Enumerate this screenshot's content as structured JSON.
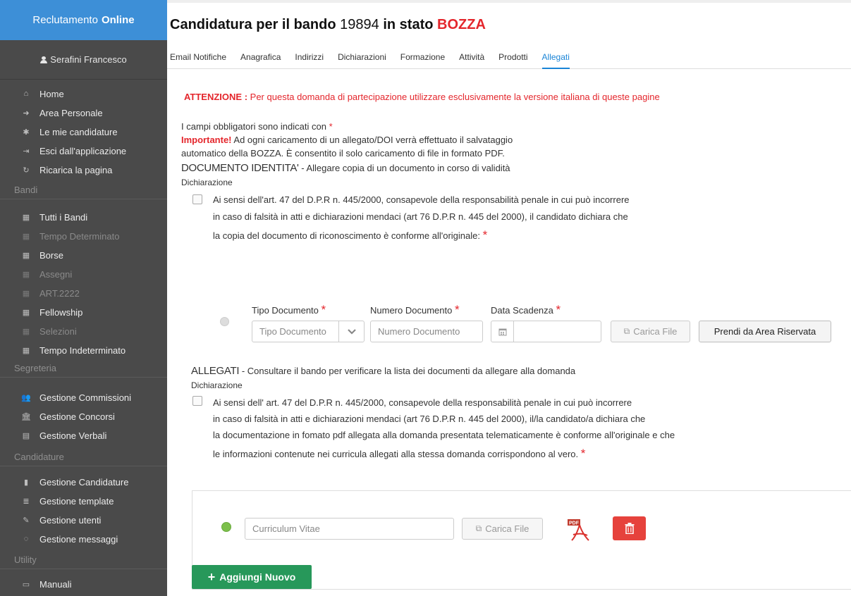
{
  "sidebar": {
    "brand_prefix": "Reclutamento",
    "brand_bold": "Online",
    "user": "Serafini Francesco",
    "items": [
      {
        "label": "Home",
        "icon": "home-icon",
        "glyph": "⌂"
      },
      {
        "label": "Area Personale",
        "icon": "sign-in-icon",
        "glyph": "➜"
      },
      {
        "label": "Le mie candidature",
        "icon": "bug-icon",
        "glyph": "✱"
      },
      {
        "label": "Esci dall'applicazione",
        "icon": "sign-out-icon",
        "glyph": "⇥"
      },
      {
        "label": "Ricarica la pagina",
        "icon": "refresh-icon",
        "glyph": "↻"
      }
    ],
    "section_bandi": "Bandi",
    "bandi_items": [
      {
        "label": "Tutti i Bandi",
        "icon": "database-icon",
        "dim": false
      },
      {
        "label": "Tempo Determinato",
        "icon": "database-icon",
        "dim": true
      },
      {
        "label": "Borse",
        "icon": "database-icon",
        "dim": false
      },
      {
        "label": "Assegni",
        "icon": "database-icon",
        "dim": true
      },
      {
        "label": "ART.2222",
        "icon": "database-icon",
        "dim": true
      },
      {
        "label": "Fellowship",
        "icon": "database-icon",
        "dim": false
      },
      {
        "label": "Selezioni",
        "icon": "database-icon",
        "dim": true
      },
      {
        "label": "Tempo Indeterminato",
        "icon": "database-icon",
        "dim": false
      }
    ],
    "section_segreteria": "Segreteria",
    "segreteria_items": [
      {
        "label": "Gestione Commissioni",
        "icon": "users-icon",
        "glyph": "👥"
      },
      {
        "label": "Gestione Concorsi",
        "icon": "bank-icon",
        "glyph": "🏛"
      },
      {
        "label": "Gestione Verbali",
        "icon": "file-icon",
        "glyph": "▤"
      }
    ],
    "section_candidature": "Candidature",
    "candidature_items": [
      {
        "label": "Gestione Candidature",
        "icon": "book-icon",
        "glyph": "▮"
      },
      {
        "label": "Gestione template",
        "icon": "list-icon",
        "glyph": "≣"
      },
      {
        "label": "Gestione utenti",
        "icon": "pencil-icon",
        "glyph": "✎"
      },
      {
        "label": "Gestione messaggi",
        "icon": "comment-icon",
        "glyph": "◌"
      }
    ],
    "section_utility": "Utility",
    "utility_items": [
      {
        "label": "Manuali",
        "icon": "folder-icon",
        "glyph": "▭"
      }
    ]
  },
  "header": {
    "title_prefix": "Candidatura per il bando",
    "bando_number": "19894",
    "title_mid": "in stato",
    "state": "BOZZA"
  },
  "tabs": [
    "Email Notifiche",
    "Anagrafica",
    "Indirizzi",
    "Dichiarazioni",
    "Formazione",
    "Attività",
    "Prodotti",
    "Allegati"
  ],
  "active_tab": "Allegati",
  "content": {
    "warning_bold": "ATTENZIONE :",
    "warning_text": "Per questa domanda di partecipazione utilizzare esclusivamente la versione italiana di queste pagine",
    "required_note": "I campi obbligatori sono indicati con",
    "required_star": "*",
    "important_bold": "Importante!",
    "important_line1": "Ad ogni caricamento di un allegato/DOI verrà effettuato il salvataggio",
    "important_line2": "automatico della BOZZA. È consentito il solo caricamento di file in formato PDF.",
    "doc_heading_caps": "DOCUMENTO IDENTITA'",
    "doc_heading_rest": "- Allegare copia di un documento in corso di validità",
    "dichiarazione_label": "Dichiarazione",
    "decl1_line1": "Ai sensi dell'art. 47 del D.P.R n. 445/2000, consapevole della responsabilità penale in cui può incorrere",
    "decl1_line2": "in caso di falsità in atti e dichiarazioni mendaci (art 76 D.P.R n. 445 del 2000), il candidato dichiara che",
    "decl1_line3": "la copia del documento di riconoscimento è conforme all'originale:",
    "tipo_documento_label": "Tipo Documento",
    "numero_documento_label": "Numero Documento",
    "data_scadenza_label": "Data Scadenza",
    "tipo_documento_placeholder": "Tipo Documento",
    "numero_documento_placeholder": "Numero Documento",
    "carica_file": "Carica File",
    "prendi_area": "Prendi da Area Riservata",
    "allegati_heading_caps": "ALLEGATI",
    "allegati_heading_rest": "- Consultare il bando per verificare la lista dei documenti da allegare alla domanda",
    "decl2_line1": "Ai sensi dell' art. 47 del D.P.R n. 445/2000, consapevole della responsabilità penale in cui può incorrere",
    "decl2_line2": "in caso di falsità in atti e dichiarazioni mendaci (art 76 D.P.R n. 445 del 2000), il/la candidato/a dichiara che",
    "decl2_line3": "la documentazione in fomato pdf allegata alla domanda presentata telematicamente è conforme all'originale e che",
    "decl2_line4": "le informazioni contenute nei curricula allegati alla stessa domanda corrispondono al vero.",
    "curriculum_placeholder": "Curriculum Vitae",
    "aggiungi_nuovo": "Aggiungi Nuovo"
  },
  "colors": {
    "brand_blue": "#3d8fd7",
    "sidebar_bg": "#4a4a4a",
    "accent_red": "#e4262c",
    "active_tab_blue": "#1a84d6",
    "add_green": "#27985a",
    "trash_red": "#e6423c",
    "status_green": "#7cc04b"
  }
}
